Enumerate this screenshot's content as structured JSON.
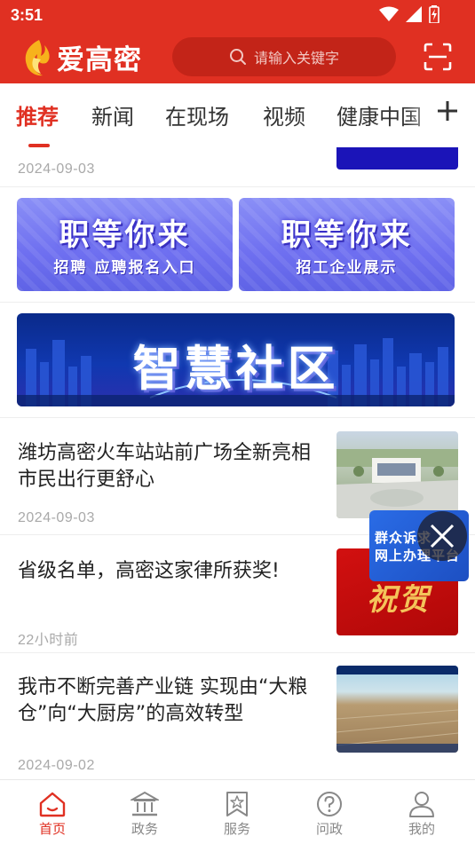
{
  "status_bar": {
    "time": "3:51"
  },
  "header": {
    "app_name": "爱高密",
    "search_placeholder": "请输入关键字"
  },
  "tabs": [
    {
      "label": "推荐",
      "active": true
    },
    {
      "label": "新闻"
    },
    {
      "label": "在现场"
    },
    {
      "label": "视频"
    },
    {
      "label": "健康中国"
    }
  ],
  "feed": {
    "top_date": "2024-09-03",
    "banners_small": [
      {
        "title": "职等你来",
        "subtitle": "招聘 应聘报名入口"
      },
      {
        "title": "职等你来",
        "subtitle": "招工企业展示"
      }
    ],
    "banner_wide": {
      "title": "智慧社区"
    },
    "articles": [
      {
        "title": "潍坊高密火车站站前广场全新亮相 市民出行更舒心",
        "time": "2024-09-03"
      },
      {
        "title": "省级名单，高密这家律所获奖!",
        "time": "22小时前",
        "thumb_text": "祝贺"
      },
      {
        "title": "我市不断完善产业链 实现由“大粮仓”向“大厨房”的高效转型",
        "time": "2024-09-02"
      }
    ]
  },
  "float_widget": {
    "line1": "群众诉求",
    "line2": "网上办理平台"
  },
  "bottom_nav": [
    {
      "label": "首页",
      "icon": "home-icon",
      "active": true
    },
    {
      "label": "政务",
      "icon": "government-building-icon"
    },
    {
      "label": "服务",
      "icon": "star-bookmark-icon"
    },
    {
      "label": "问政",
      "icon": "question-icon"
    },
    {
      "label": "我的",
      "icon": "user-icon"
    }
  ],
  "colors": {
    "brand": "#e03022",
    "search_bg": "#c32418",
    "inactive": "#888888"
  }
}
